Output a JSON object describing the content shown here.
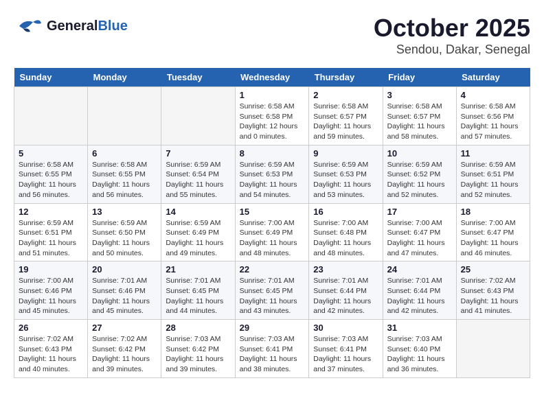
{
  "logo": {
    "line1": "General",
    "line2": "Blue"
  },
  "title": "October 2025",
  "subtitle": "Sendou, Dakar, Senegal",
  "weekdays": [
    "Sunday",
    "Monday",
    "Tuesday",
    "Wednesday",
    "Thursday",
    "Friday",
    "Saturday"
  ],
  "weeks": [
    [
      {
        "day": "",
        "info": ""
      },
      {
        "day": "",
        "info": ""
      },
      {
        "day": "",
        "info": ""
      },
      {
        "day": "1",
        "info": "Sunrise: 6:58 AM\nSunset: 6:58 PM\nDaylight: 12 hours\nand 0 minutes."
      },
      {
        "day": "2",
        "info": "Sunrise: 6:58 AM\nSunset: 6:57 PM\nDaylight: 11 hours\nand 59 minutes."
      },
      {
        "day": "3",
        "info": "Sunrise: 6:58 AM\nSunset: 6:57 PM\nDaylight: 11 hours\nand 58 minutes."
      },
      {
        "day": "4",
        "info": "Sunrise: 6:58 AM\nSunset: 6:56 PM\nDaylight: 11 hours\nand 57 minutes."
      }
    ],
    [
      {
        "day": "5",
        "info": "Sunrise: 6:58 AM\nSunset: 6:55 PM\nDaylight: 11 hours\nand 56 minutes."
      },
      {
        "day": "6",
        "info": "Sunrise: 6:58 AM\nSunset: 6:55 PM\nDaylight: 11 hours\nand 56 minutes."
      },
      {
        "day": "7",
        "info": "Sunrise: 6:59 AM\nSunset: 6:54 PM\nDaylight: 11 hours\nand 55 minutes."
      },
      {
        "day": "8",
        "info": "Sunrise: 6:59 AM\nSunset: 6:53 PM\nDaylight: 11 hours\nand 54 minutes."
      },
      {
        "day": "9",
        "info": "Sunrise: 6:59 AM\nSunset: 6:53 PM\nDaylight: 11 hours\nand 53 minutes."
      },
      {
        "day": "10",
        "info": "Sunrise: 6:59 AM\nSunset: 6:52 PM\nDaylight: 11 hours\nand 52 minutes."
      },
      {
        "day": "11",
        "info": "Sunrise: 6:59 AM\nSunset: 6:51 PM\nDaylight: 11 hours\nand 52 minutes."
      }
    ],
    [
      {
        "day": "12",
        "info": "Sunrise: 6:59 AM\nSunset: 6:51 PM\nDaylight: 11 hours\nand 51 minutes."
      },
      {
        "day": "13",
        "info": "Sunrise: 6:59 AM\nSunset: 6:50 PM\nDaylight: 11 hours\nand 50 minutes."
      },
      {
        "day": "14",
        "info": "Sunrise: 6:59 AM\nSunset: 6:49 PM\nDaylight: 11 hours\nand 49 minutes."
      },
      {
        "day": "15",
        "info": "Sunrise: 7:00 AM\nSunset: 6:49 PM\nDaylight: 11 hours\nand 48 minutes."
      },
      {
        "day": "16",
        "info": "Sunrise: 7:00 AM\nSunset: 6:48 PM\nDaylight: 11 hours\nand 48 minutes."
      },
      {
        "day": "17",
        "info": "Sunrise: 7:00 AM\nSunset: 6:47 PM\nDaylight: 11 hours\nand 47 minutes."
      },
      {
        "day": "18",
        "info": "Sunrise: 7:00 AM\nSunset: 6:47 PM\nDaylight: 11 hours\nand 46 minutes."
      }
    ],
    [
      {
        "day": "19",
        "info": "Sunrise: 7:00 AM\nSunset: 6:46 PM\nDaylight: 11 hours\nand 45 minutes."
      },
      {
        "day": "20",
        "info": "Sunrise: 7:01 AM\nSunset: 6:46 PM\nDaylight: 11 hours\nand 45 minutes."
      },
      {
        "day": "21",
        "info": "Sunrise: 7:01 AM\nSunset: 6:45 PM\nDaylight: 11 hours\nand 44 minutes."
      },
      {
        "day": "22",
        "info": "Sunrise: 7:01 AM\nSunset: 6:45 PM\nDaylight: 11 hours\nand 43 minutes."
      },
      {
        "day": "23",
        "info": "Sunrise: 7:01 AM\nSunset: 6:44 PM\nDaylight: 11 hours\nand 42 minutes."
      },
      {
        "day": "24",
        "info": "Sunrise: 7:01 AM\nSunset: 6:44 PM\nDaylight: 11 hours\nand 42 minutes."
      },
      {
        "day": "25",
        "info": "Sunrise: 7:02 AM\nSunset: 6:43 PM\nDaylight: 11 hours\nand 41 minutes."
      }
    ],
    [
      {
        "day": "26",
        "info": "Sunrise: 7:02 AM\nSunset: 6:43 PM\nDaylight: 11 hours\nand 40 minutes."
      },
      {
        "day": "27",
        "info": "Sunrise: 7:02 AM\nSunset: 6:42 PM\nDaylight: 11 hours\nand 39 minutes."
      },
      {
        "day": "28",
        "info": "Sunrise: 7:03 AM\nSunset: 6:42 PM\nDaylight: 11 hours\nand 39 minutes."
      },
      {
        "day": "29",
        "info": "Sunrise: 7:03 AM\nSunset: 6:41 PM\nDaylight: 11 hours\nand 38 minutes."
      },
      {
        "day": "30",
        "info": "Sunrise: 7:03 AM\nSunset: 6:41 PM\nDaylight: 11 hours\nand 37 minutes."
      },
      {
        "day": "31",
        "info": "Sunrise: 7:03 AM\nSunset: 6:40 PM\nDaylight: 11 hours\nand 36 minutes."
      },
      {
        "day": "",
        "info": ""
      }
    ]
  ]
}
